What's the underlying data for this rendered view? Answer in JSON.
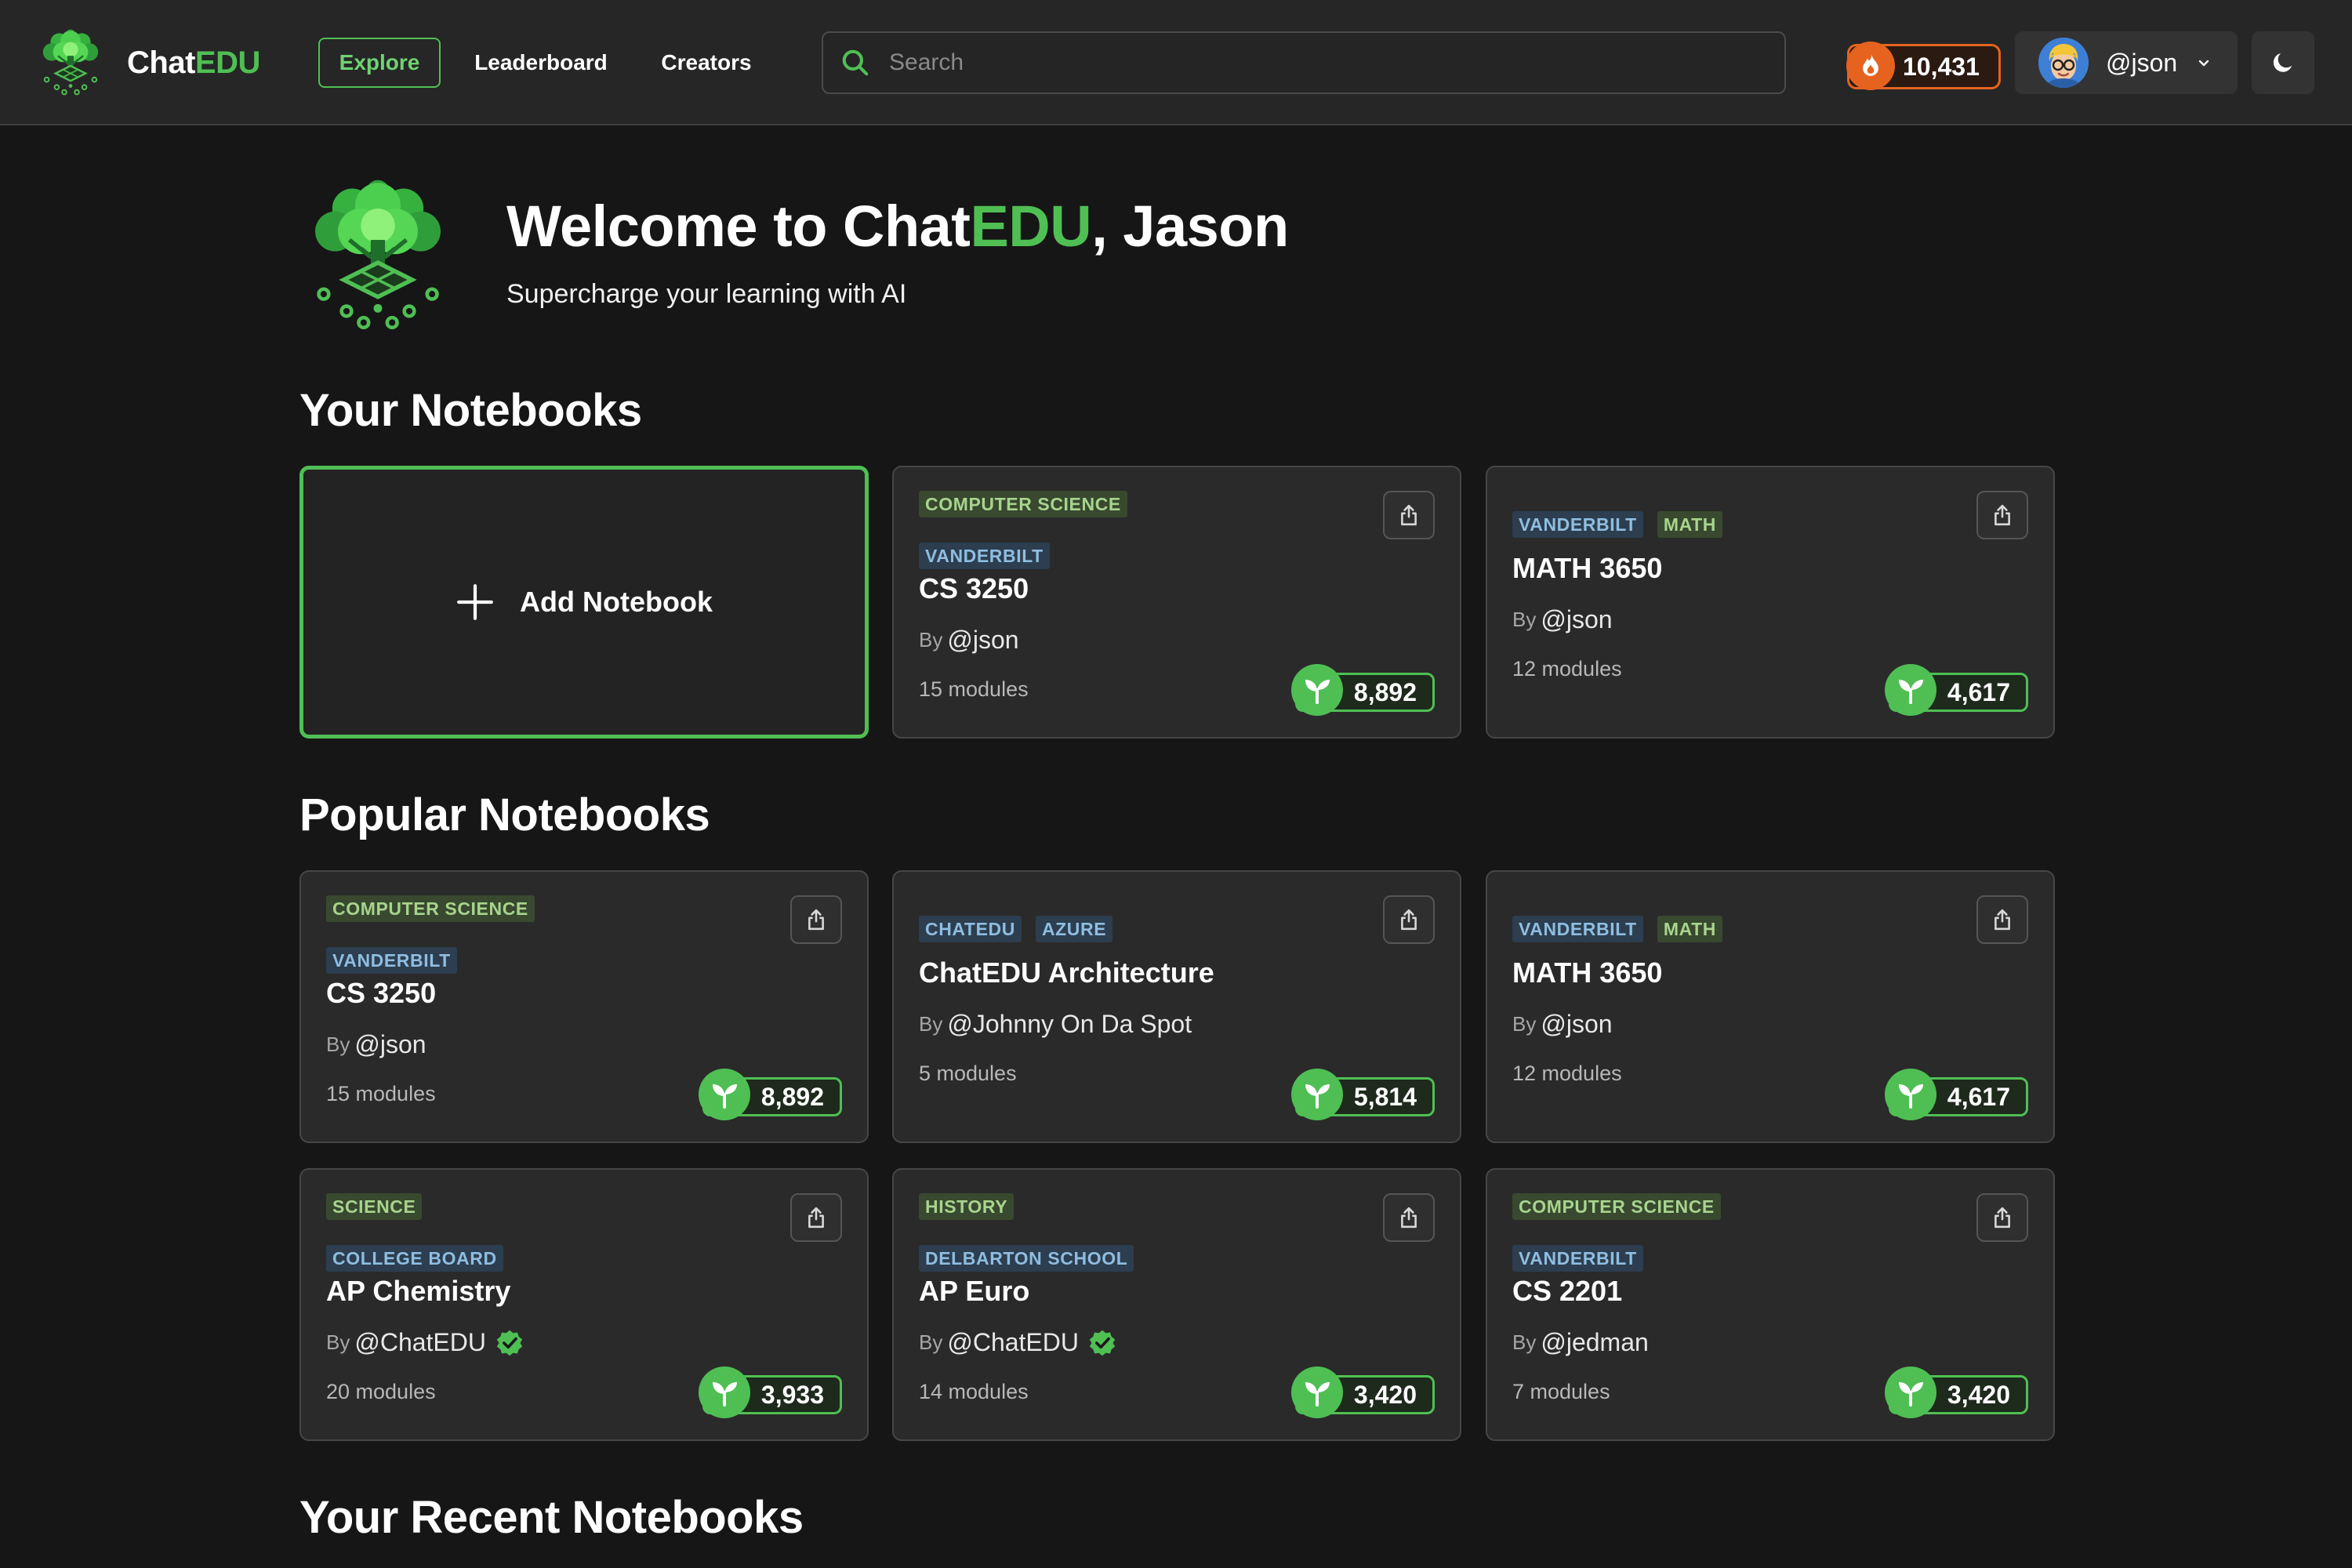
{
  "brand": {
    "name_prefix": "Chat",
    "name_suffix": "EDU"
  },
  "nav": {
    "explore": "Explore",
    "leaderboard": "Leaderboard",
    "creators": "Creators"
  },
  "search": {
    "placeholder": "Search"
  },
  "user": {
    "points": "10,431",
    "handle": "@json"
  },
  "hero": {
    "title_prefix": "Welcome to Chat",
    "title_highlight": "EDU",
    "title_suffix": ", Jason",
    "subtitle": "Supercharge your learning with AI"
  },
  "sections": {
    "your_notebooks": "Your Notebooks",
    "popular_notebooks": "Popular Notebooks",
    "recent_notebooks": "Your Recent Notebooks"
  },
  "add_notebook_label": "Add Notebook",
  "by_label": "By",
  "colors": {
    "accent": "#4fbf54",
    "points": "#e5631f",
    "background": "#161616",
    "card": "#2a2a2a"
  },
  "your_notebooks": [
    {
      "tags": [
        {
          "label": "COMPUTER SCIENCE",
          "color": "green"
        },
        {
          "label": "VANDERBILT",
          "color": "blue"
        }
      ],
      "title": "CS 3250",
      "author": "@json",
      "modules": "15 modules",
      "score": "8,892"
    },
    {
      "tags": [
        {
          "label": "VANDERBILT",
          "color": "blue"
        },
        {
          "label": "MATH",
          "color": "green"
        }
      ],
      "title": "MATH 3650",
      "author": "@json",
      "modules": "12 modules",
      "score": "4,617"
    }
  ],
  "popular_notebooks": [
    {
      "tags": [
        {
          "label": "COMPUTER SCIENCE",
          "color": "green"
        },
        {
          "label": "VANDERBILT",
          "color": "blue"
        }
      ],
      "title": "CS 3250",
      "author": "@json",
      "verified": false,
      "modules": "15 modules",
      "score": "8,892"
    },
    {
      "tags": [
        {
          "label": "CHATEDU",
          "color": "blue"
        },
        {
          "label": "AZURE",
          "color": "blue"
        }
      ],
      "title": "ChatEDU Architecture",
      "author": "@Johnny On Da Spot",
      "verified": false,
      "modules": "5 modules",
      "score": "5,814"
    },
    {
      "tags": [
        {
          "label": "VANDERBILT",
          "color": "blue"
        },
        {
          "label": "MATH",
          "color": "green"
        }
      ],
      "title": "MATH 3650",
      "author": "@json",
      "verified": false,
      "modules": "12 modules",
      "score": "4,617"
    },
    {
      "tags": [
        {
          "label": "SCIENCE",
          "color": "green"
        },
        {
          "label": "COLLEGE BOARD",
          "color": "blue"
        }
      ],
      "title": "AP Chemistry",
      "author": "@ChatEDU",
      "verified": true,
      "modules": "20 modules",
      "score": "3,933"
    },
    {
      "tags": [
        {
          "label": "HISTORY",
          "color": "green"
        },
        {
          "label": "DELBARTON SCHOOL",
          "color": "blue"
        }
      ],
      "title": "AP Euro",
      "author": "@ChatEDU",
      "verified": true,
      "modules": "14 modules",
      "score": "3,420"
    },
    {
      "tags": [
        {
          "label": "COMPUTER SCIENCE",
          "color": "green"
        },
        {
          "label": "VANDERBILT",
          "color": "blue"
        }
      ],
      "title": "CS 2201",
      "author": "@jedman",
      "verified": false,
      "modules": "7 modules",
      "score": "3,420"
    }
  ]
}
